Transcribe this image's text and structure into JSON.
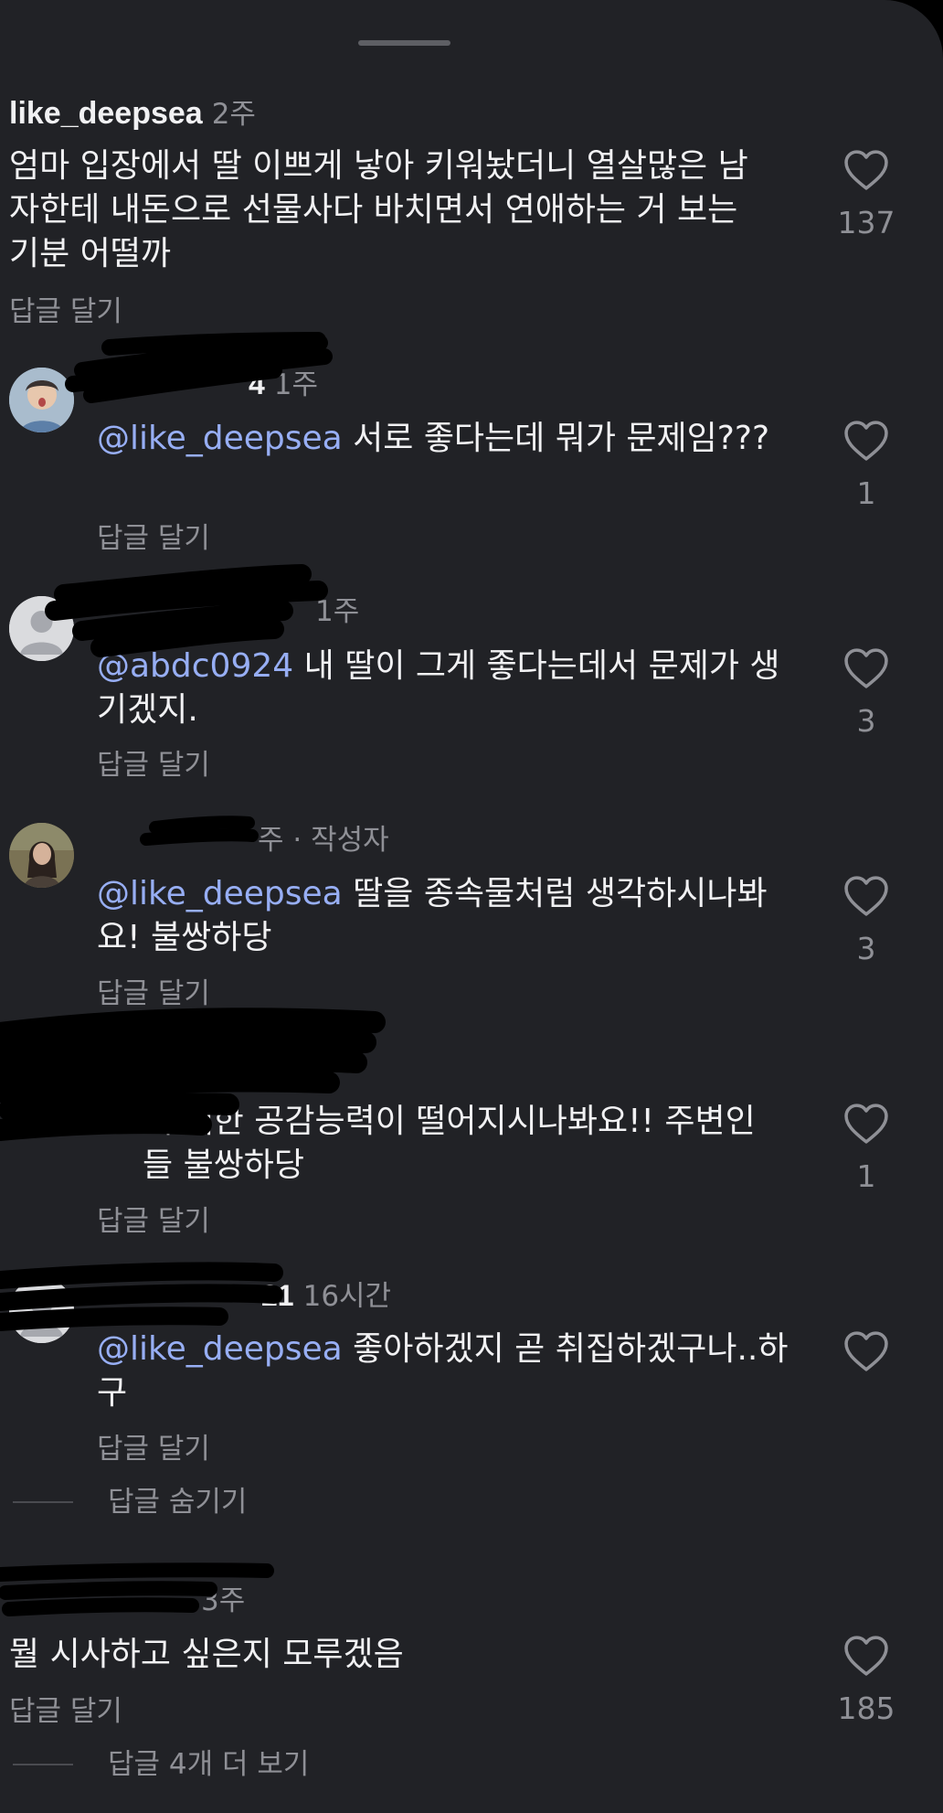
{
  "colors": {
    "background": "#212226",
    "text": "#f1f1f3",
    "muted": "#8f9096",
    "mention": "#97aef4"
  },
  "comments": [
    {
      "username": "like_deepsea",
      "time": "2주",
      "text": "엄마 입장에서 딸 이쁘게 낳아 키워놨더니 열살많은 남자한테 내돈으로 선물사다 바치면서 연애하는 거 보는 기분 어떨까",
      "reply_label": "답글 달기",
      "like_count": "137"
    }
  ],
  "replies": [
    {
      "username": "",
      "visible_fragment": "4",
      "time": "1주",
      "mention": "@like_deepsea",
      "text": " 서로 좋다는데 뭐가 문제임???",
      "reply_label": "답글 달기",
      "like_count": "1"
    },
    {
      "username": "",
      "time": "1주",
      "mention": "@abdc0924",
      "text": " 내 딸이 그게 좋다는데서 문제가 생기겠지.",
      "reply_label": "답글 달기",
      "like_count": "3"
    },
    {
      "username": "",
      "time": "주",
      "author_badge": "· 작성자",
      "mention": "@like_deepsea",
      "text": " 딸을 종속물처럼 생각하시나봐요! 불쌍하당",
      "reply_label": "답글 달기",
      "like_count": "3"
    },
    {
      "username": "",
      "time": "",
      "mention": "",
      "text": "에 대한 공감능력이 떨어지시나봐요!! 주변인들 불쌍하당",
      "reply_label": "답글 달기",
      "like_count": "1"
    },
    {
      "username": "",
      "visible_fragment": "21",
      "time": "16시간",
      "mention": "@like_deepsea",
      "text": " 좋아하겠지 곧 취집하겠구나..하구",
      "reply_label": "답글 달기",
      "like_count": ""
    }
  ],
  "hide_replies_label": "답글 숨기기",
  "comment_two": {
    "username": "",
    "time": "3주",
    "text": "뭘 시사하고 싶은지 모루겠음",
    "reply_label": "답글 달기",
    "like_count": "185"
  },
  "more_replies_label": "답글 4개 더 보기",
  "icons": {
    "like": "heart-outline-icon"
  }
}
